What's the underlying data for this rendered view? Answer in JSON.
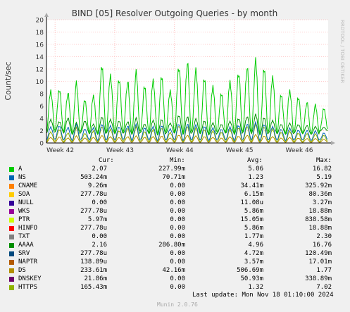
{
  "page": {
    "title": "BIND [05] Resolver Outgoing Queries - by month",
    "ylabel": "Count/sec",
    "watermark": "RRDTOOL / TOBI OETIKER",
    "last_update": "Last update: Mon Nov 18 01:10:00 2024",
    "generator": "Munin 2.0.76",
    "background": "#f0f0f0",
    "plot_background": "#ffffff",
    "grid_color": "#ff9999"
  },
  "legend": {
    "headers": {
      "cur": "Cur:",
      "min": "Min:",
      "avg": "Avg:",
      "max": "Max:"
    },
    "rows": [
      {
        "name": "A",
        "color": "#00cc00",
        "cur": "2.07",
        "min": "227.99m",
        "avg": "5.06",
        "max": "16.82"
      },
      {
        "name": "NS",
        "color": "#0066b3",
        "cur": "503.24m",
        "min": "70.71m",
        "avg": "1.23",
        "max": "5.19"
      },
      {
        "name": "CNAME",
        "color": "#ff8000",
        "cur": "9.26m",
        "min": "0.00",
        "avg": "34.41m",
        "max": "325.92m"
      },
      {
        "name": "SOA",
        "color": "#ffcc00",
        "cur": "277.78u",
        "min": "0.00",
        "avg": "6.15m",
        "max": "80.36m"
      },
      {
        "name": "NULL",
        "color": "#330099",
        "cur": "0.00",
        "min": "0.00",
        "avg": "11.08u",
        "max": "3.27m"
      },
      {
        "name": "WKS",
        "color": "#990099",
        "cur": "277.78u",
        "min": "0.00",
        "avg": "5.86m",
        "max": "18.88m"
      },
      {
        "name": "PTR",
        "color": "#ccff00",
        "cur": "5.97m",
        "min": "0.00",
        "avg": "15.05m",
        "max": "838.58m"
      },
      {
        "name": "HINFO",
        "color": "#ff0000",
        "cur": "277.78u",
        "min": "0.00",
        "avg": "5.86m",
        "max": "18.88m"
      },
      {
        "name": "TXT",
        "color": "#808080",
        "cur": "0.00",
        "min": "0.00",
        "avg": "1.77m",
        "max": "2.30"
      },
      {
        "name": "AAAA",
        "color": "#008f00",
        "cur": "2.16",
        "min": "286.80m",
        "avg": "4.96",
        "max": "16.76"
      },
      {
        "name": "SRV",
        "color": "#00487d",
        "cur": "277.78u",
        "min": "0.00",
        "avg": "4.72m",
        "max": "120.49m"
      },
      {
        "name": "NAPTR",
        "color": "#b35a00",
        "cur": "138.89u",
        "min": "0.00",
        "avg": "3.57m",
        "max": "17.01m"
      },
      {
        "name": "DS",
        "color": "#b38f00",
        "cur": "233.61m",
        "min": "42.16m",
        "avg": "506.69m",
        "max": "1.77"
      },
      {
        "name": "DNSKEY",
        "color": "#6b006b",
        "cur": "21.86m",
        "min": "0.00",
        "avg": "50.93m",
        "max": "338.89m"
      },
      {
        "name": "HTTPS",
        "color": "#8fb300",
        "cur": "165.43m",
        "min": "0.00",
        "avg": "1.32",
        "max": "7.02"
      }
    ]
  },
  "chart_data": {
    "type": "line",
    "title": "BIND [05] Resolver Outgoing Queries - by month",
    "xlabel": "",
    "ylabel": "Count/sec",
    "x_tick_labels": [
      "Week 42",
      "Week 43",
      "Week 44",
      "Week 45",
      "Week 46"
    ],
    "x_domain": [
      0,
      33
    ],
    "x_ticks": [
      1,
      8,
      15,
      22,
      29
    ],
    "y_ticks": [
      0,
      2,
      4,
      6,
      8,
      10,
      12,
      14,
      16,
      18,
      20
    ],
    "ylim": [
      0,
      20
    ],
    "grid": true,
    "series": [
      {
        "name": "A",
        "color": "#00cc00",
        "daily_peaks": [
          8.5,
          8.8,
          8.0,
          9.5,
          6.8,
          7.5,
          12.5,
          11.0,
          10.5,
          9.8,
          11.2,
          9.0,
          10.0,
          10.8,
          8.5,
          12.5,
          12.8,
          11.5,
          10.2,
          9.0,
          8.0,
          10.0,
          11.5,
          12.0,
          13.0,
          11.8,
          10.5,
          7.8,
          8.5,
          7.5,
          6.5,
          6.0,
          5.5
        ],
        "daily_troughs": [
          1.8,
          2.0,
          1.8,
          1.5,
          1.9,
          1.6,
          1.5,
          1.7,
          1.6,
          1.8,
          1.5,
          1.9,
          1.6,
          1.4,
          1.8,
          1.7,
          1.5,
          1.8,
          1.6,
          1.4,
          1.8,
          1.7,
          1.5,
          1.8,
          1.6,
          1.4,
          1.8,
          1.6,
          1.5,
          1.7,
          1.6,
          1.5,
          2.0
        ]
      },
      {
        "name": "AAAA",
        "color": "#008f00",
        "daily_peaks": [
          3.8,
          3.5,
          4.0,
          3.2,
          3.5,
          3.0,
          4.2,
          3.8,
          3.6,
          3.4,
          3.9,
          3.0,
          3.6,
          3.8,
          3.2,
          4.5,
          4.2,
          3.8,
          3.5,
          3.2,
          3.0,
          3.5,
          4.0,
          4.2,
          4.5,
          4.0,
          3.6,
          3.0,
          3.2,
          3.0,
          2.8,
          2.6,
          2.5
        ],
        "daily_troughs": [
          1.6,
          1.8,
          1.6,
          1.4,
          1.7,
          1.5,
          1.4,
          1.6,
          1.5,
          1.6,
          1.4,
          1.7,
          1.5,
          1.3,
          1.6,
          1.6,
          1.4,
          1.6,
          1.5,
          1.3,
          1.6,
          1.6,
          1.4,
          1.7,
          1.5,
          1.3,
          1.6,
          1.5,
          1.4,
          1.6,
          1.5,
          1.4,
          1.9
        ]
      },
      {
        "name": "NS",
        "color": "#0066b3",
        "daily_peaks": [
          2.6,
          2.8,
          2.5,
          2.9,
          2.2,
          2.4,
          3.0,
          2.8,
          2.6,
          2.7,
          2.9,
          2.4,
          2.6,
          2.8,
          2.3,
          3.1,
          3.0,
          2.8,
          2.6,
          2.4,
          2.2,
          2.6,
          2.9,
          3.0,
          3.2,
          2.9,
          2.6,
          2.2,
          2.4,
          2.1,
          2.0,
          1.9,
          1.6
        ],
        "daily_troughs": [
          0.5,
          0.6,
          0.5,
          0.4,
          0.6,
          0.5,
          0.4,
          0.5,
          0.5,
          0.6,
          0.4,
          0.6,
          0.5,
          0.4,
          0.5,
          0.5,
          0.4,
          0.5,
          0.5,
          0.4,
          0.6,
          0.5,
          0.4,
          0.6,
          0.5,
          0.4,
          0.5,
          0.5,
          0.4,
          0.5,
          0.5,
          0.4,
          0.5
        ]
      },
      {
        "name": "HTTPS",
        "color": "#8fb300",
        "daily_peaks": [
          1.8,
          2.2,
          1.6,
          2.4,
          1.5,
          1.9,
          2.6,
          2.2,
          2.0,
          2.3,
          2.5,
          1.8,
          2.1,
          2.4,
          1.7,
          2.8,
          2.6,
          2.3,
          2.1,
          1.9,
          1.7,
          2.2,
          2.5,
          2.6,
          2.9,
          2.5,
          2.2,
          1.7,
          1.9,
          1.6,
          1.5,
          1.4,
          1.2
        ],
        "daily_troughs": [
          0.2,
          0.3,
          0.2,
          0.2,
          0.3,
          0.2,
          0.2,
          0.2,
          0.2,
          0.3,
          0.2,
          0.3,
          0.2,
          0.2,
          0.2,
          0.2,
          0.2,
          0.2,
          0.2,
          0.2,
          0.3,
          0.2,
          0.2,
          0.3,
          0.2,
          0.2,
          0.2,
          0.2,
          0.2,
          0.2,
          0.2,
          0.2,
          0.2
        ]
      },
      {
        "name": "DS",
        "color": "#b38f00",
        "daily_peaks": [
          0.9,
          1.0,
          0.8,
          1.1,
          0.8,
          0.9,
          1.2,
          1.0,
          0.9,
          1.0,
          1.1,
          0.9,
          1.0,
          1.1,
          0.8,
          1.3,
          1.2,
          1.1,
          1.0,
          0.9,
          0.8,
          1.0,
          1.1,
          1.2,
          1.3,
          1.1,
          1.0,
          0.8,
          0.9,
          0.8,
          0.7,
          0.7,
          0.6
        ],
        "daily_troughs": [
          0.1,
          0.1,
          0.1,
          0.1,
          0.1,
          0.1,
          0.1,
          0.1,
          0.1,
          0.1,
          0.1,
          0.1,
          0.1,
          0.1,
          0.1,
          0.1,
          0.1,
          0.1,
          0.1,
          0.1,
          0.1,
          0.1,
          0.1,
          0.1,
          0.1,
          0.1,
          0.1,
          0.1,
          0.1,
          0.1,
          0.1,
          0.1,
          0.1
        ]
      }
    ]
  }
}
